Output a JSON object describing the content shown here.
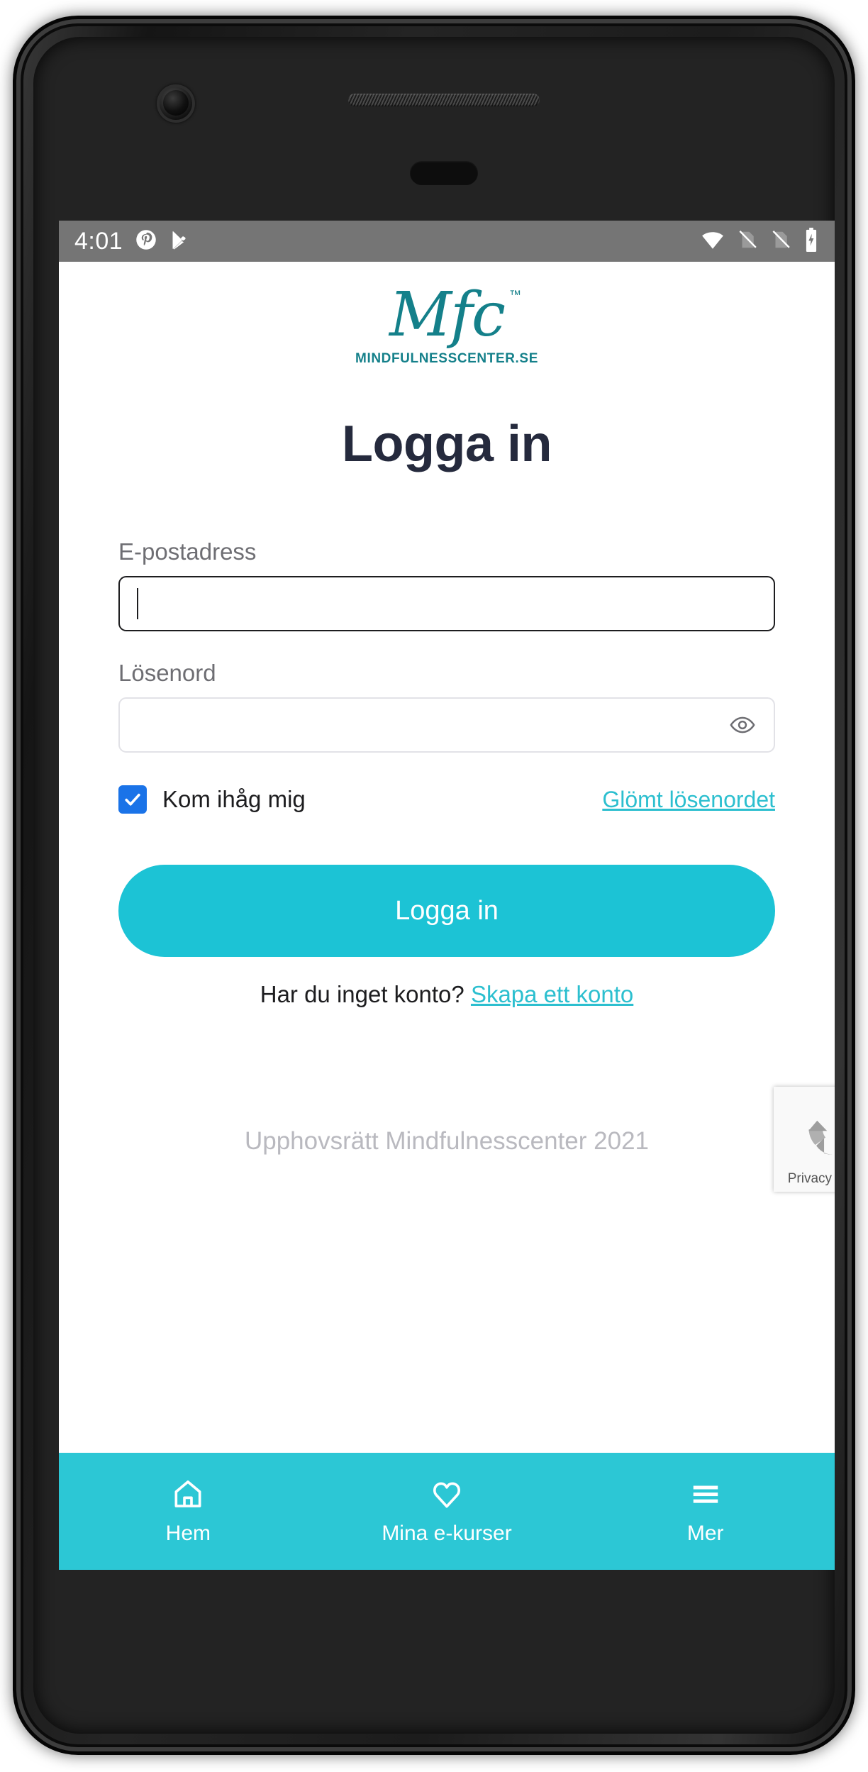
{
  "status_bar": {
    "time": "4:01",
    "left_icons": [
      "pinterest-icon",
      "play-store-icon"
    ],
    "right_icons": [
      "wifi-icon",
      "sim-card-off-icon",
      "sim-card-off-icon",
      "battery-charging-icon"
    ],
    "background_color": "#757575"
  },
  "brand": {
    "logo_mark": "Mfc",
    "trademark": "™",
    "wordmark": "MINDFULNESSCENTER.SE",
    "color": "#14808a"
  },
  "page": {
    "title": "Logga in"
  },
  "form": {
    "email": {
      "label": "E-postadress",
      "value": "",
      "placeholder": "",
      "focused": true
    },
    "password": {
      "label": "Lösenord",
      "value": "",
      "placeholder": "",
      "toggle_icon": "eye-icon"
    },
    "remember_me": {
      "label": "Kom ihåg mig",
      "checked": true,
      "color": "#1a73e8"
    },
    "forgot_password_link": "Glömt lösenordet",
    "submit_label": "Logga in",
    "submit_color": "#1cc3d5"
  },
  "signup": {
    "prompt": "Har du inget konto?",
    "link": "Skapa ett konto",
    "link_color": "#2cbfcf"
  },
  "footer": {
    "copyright": "Upphovsrätt Mindfulnesscenter 2021"
  },
  "recaptcha": {
    "icon": "recaptcha-icon",
    "terms": "Privacy - Terms"
  },
  "bottom_nav": {
    "background_color": "#2cc7d5",
    "items": [
      {
        "label": "Hem",
        "icon": "home-icon"
      },
      {
        "label": "Mina e-kurser",
        "icon": "heart-icon"
      },
      {
        "label": "Mer",
        "icon": "hamburger-menu-icon"
      }
    ]
  }
}
